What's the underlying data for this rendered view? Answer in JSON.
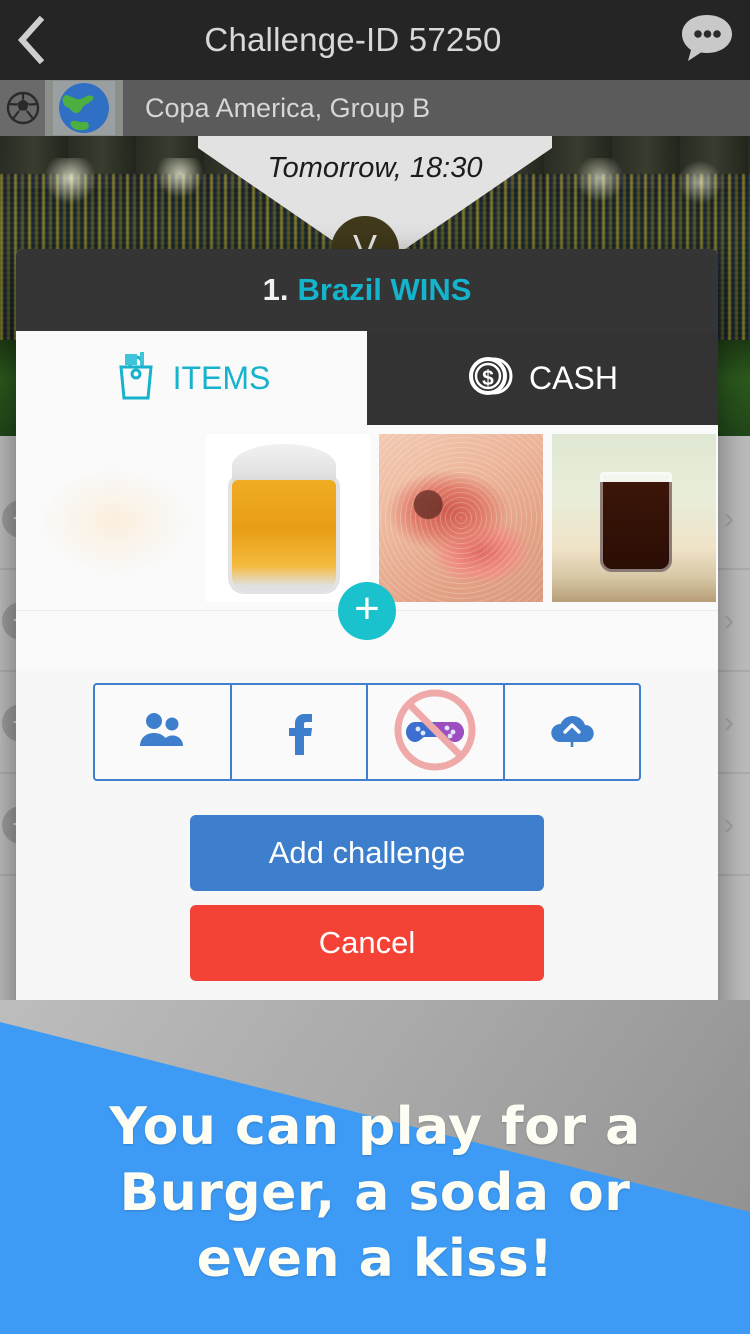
{
  "nav": {
    "back_icon": "chevron-left-icon",
    "title": "Challenge-ID 57250",
    "chat_icon": "chat-bubble-icon"
  },
  "subbar": {
    "sport_icon": "soccer-ball-icon",
    "region_icon": "globe-icon",
    "league": "Copa America, Group B"
  },
  "match": {
    "time": "Tomorrow, 18:30",
    "vs_label": "V"
  },
  "modal": {
    "header": {
      "number": "1.",
      "outcome": "Brazil WINS"
    },
    "tabs": [
      {
        "label": "ITEMS",
        "icon": "shopping-bag-icon",
        "active": true
      },
      {
        "label": "CASH",
        "icon": "dollar-coin-icon",
        "active": false
      }
    ],
    "items": [
      {
        "name": "burger-thumbnail"
      },
      {
        "name": "beer-thumbnail"
      },
      {
        "name": "kiss-thumbnail"
      },
      {
        "name": "soda-thumbnail"
      }
    ],
    "add_item_icon": "plus-icon",
    "share_options": [
      {
        "icon": "friends-icon",
        "name": "share-friends"
      },
      {
        "icon": "facebook-icon",
        "name": "share-facebook"
      },
      {
        "icon": "no-gamepad-icon",
        "name": "share-random-opponent-disabled"
      },
      {
        "icon": "cloud-upload-icon",
        "name": "share-public"
      }
    ],
    "buttons": {
      "add": "Add challenge",
      "cancel": "Cancel"
    }
  },
  "banner": {
    "line1": "You can play for a",
    "line2": "Burger, a soda or",
    "line3": "even a kiss!"
  },
  "colors": {
    "accent_teal": "#17b3cc",
    "primary_blue": "#3d7fcc",
    "danger_red": "#f44336",
    "banner_blue": "#3d9bf5",
    "dark_header": "#353535"
  }
}
